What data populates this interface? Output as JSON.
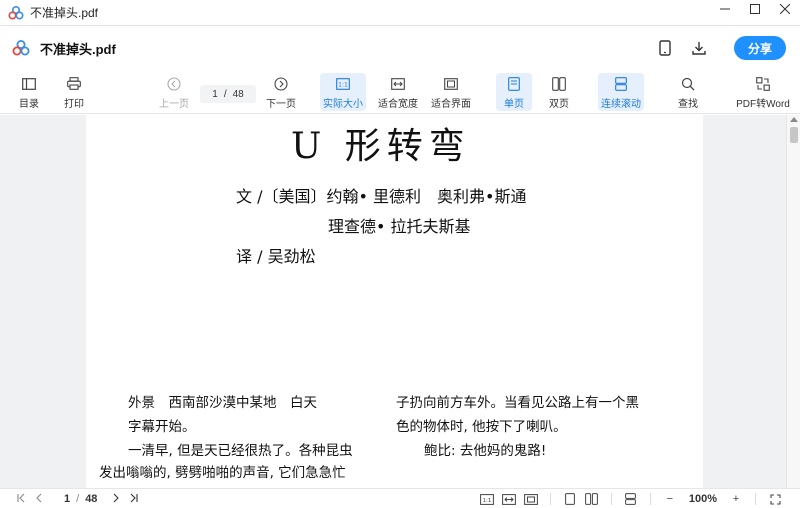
{
  "window": {
    "title": "不准掉头.pdf",
    "controls": [
      "minimize",
      "maximize",
      "close"
    ]
  },
  "header": {
    "doc_title": "不准掉头.pdf",
    "share_label": "分享",
    "icons": [
      "phone-icon",
      "download-icon"
    ]
  },
  "toolbar": {
    "outline": "目录",
    "print": "打印",
    "prev_page": "上一页",
    "current_page": "1",
    "page_sep": "/",
    "total_pages": "48",
    "next_page": "下一页",
    "actual_size": "实际大小",
    "fit_width": "适合宽度",
    "fit_page": "适合界面",
    "single_page": "单页",
    "two_page": "双页",
    "continuous": "连续滚动",
    "search": "查找",
    "pdf_to_word": "PDF转Word"
  },
  "document": {
    "title": "U 形转弯",
    "byline_1": "文 /〔美国〕约翰• 里德利　奥利弗•斯通",
    "byline_2": "理查德• 拉托夫斯基",
    "byline_3": "译 /  吴劲松",
    "left_col": [
      "外景　西南部沙漠中某地　白天",
      "字幕开始。",
      "一清早, 但是天已经很热了。各种昆虫",
      "发出嗡嗡的, 劈劈啪啪的声音, 它们急急忙"
    ],
    "right_col": [
      "子扔向前方车外。当看见公路上有一个黑",
      "色的物体时, 他按下了喇叭。",
      "鲍比: 去他妈的鬼路!"
    ]
  },
  "statusbar": {
    "current_page": "1",
    "page_sep": "/",
    "total_pages": "48",
    "zoom": "100%",
    "zoom_out": "−",
    "zoom_in": "+"
  },
  "colors": {
    "accent": "#1e90ff",
    "active_bg": "#e6f0fc",
    "viewer_bg": "#f0f1f3"
  }
}
